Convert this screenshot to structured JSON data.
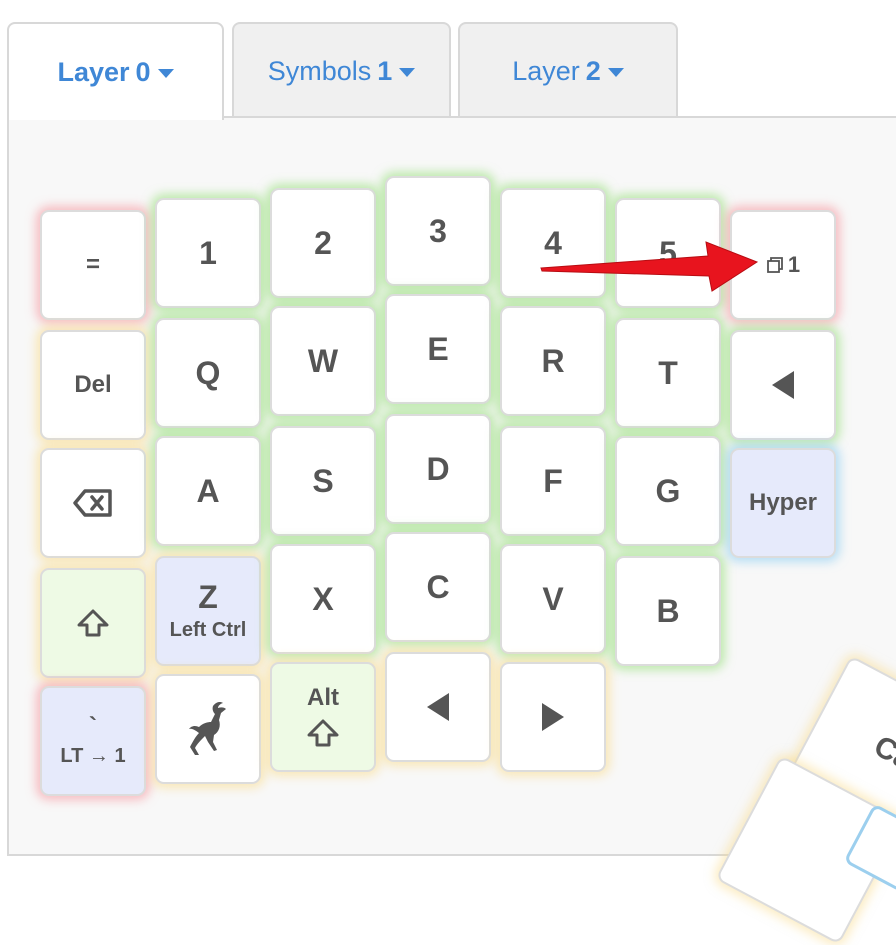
{
  "tabs": [
    {
      "label": "Layer",
      "num": "0"
    },
    {
      "label": "Symbols",
      "num": "1"
    },
    {
      "label": "Layer",
      "num": "2"
    }
  ],
  "keys": {
    "equals": "=",
    "k1": "1",
    "k2": "2",
    "k3": "3",
    "k4": "4",
    "k5": "5",
    "layer_toggle": "1",
    "del": "Del",
    "q": "Q",
    "w": "W",
    "e": "E",
    "r": "R",
    "t": "T",
    "a": "A",
    "s": "S",
    "d": "D",
    "f": "F",
    "g": "G",
    "hyper": "Hyper",
    "z": "Z",
    "z_sub": "Left Ctrl",
    "x": "X",
    "c": "C",
    "v": "V",
    "b": "B",
    "grave": "`",
    "grave_sub": "LT → 1",
    "alt": "Alt"
  },
  "thumb": {
    "label": "Ca"
  },
  "icons": [
    "copy-icon",
    "triangle-left-icon",
    "backspace-icon",
    "shift-up-icon",
    "gazelle-icon",
    "triangle-right-icon",
    "annotation-arrow"
  ],
  "colors": {
    "accent": "#3f87d6",
    "arrow": "#e8141e",
    "glow_green": "#8cdc6e",
    "glow_yellow": "#fadc8c",
    "glow_red": "#f58c96",
    "glow_blue": "#82c8f0"
  }
}
